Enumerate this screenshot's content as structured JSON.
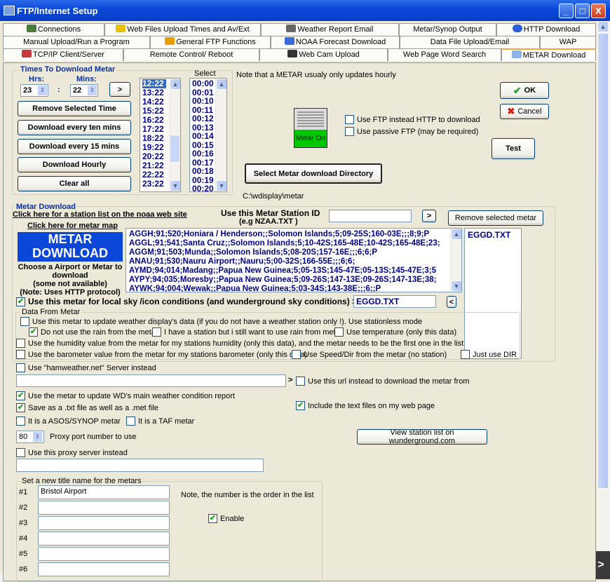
{
  "window": {
    "title": "FTP/Internet Setup",
    "min": "_",
    "max": "□",
    "close": "X"
  },
  "tabs_row1": [
    "Connections",
    "Web Files Upload Times and  Av/Ext",
    "Weather Report Email",
    "Metar/Synop Output",
    "HTTP Download"
  ],
  "tabs_row2": [
    "Manual Upload/Run a Program",
    "General FTP Functions",
    "NOAA Forecast Download",
    "Data File Upload/Email",
    "WAP"
  ],
  "tabs_row3": [
    "TCP/IP Client/Server",
    "Remote Control/ Reboot",
    "Web Cam Upload",
    "Web Page Word Search",
    "METAR Download"
  ],
  "times": {
    "group_label": "Times To Download Metar",
    "hrs_label": "Hrs:",
    "mins_label": "Mins:",
    "hrs_value": "23",
    "mins_value": "22",
    "colon": ":",
    "add_arrow": ">",
    "remove": "Remove Selected Time",
    "every10": "Download every ten mins",
    "every15": "Download every 15 mins",
    "hourly": "Download Hourly",
    "clear": "Clear all",
    "list": [
      "12:22",
      "13:22",
      "14:22",
      "15:22",
      "16:22",
      "17:22",
      "18:22",
      "19:22",
      "20:22",
      "21:22",
      "22:22",
      "23:22"
    ],
    "select_label": "Select",
    "select_list": [
      "00:00",
      "00:01",
      "00:10",
      "00:11",
      "00:12",
      "00:13",
      "00:14",
      "00:15",
      "00:16",
      "00:17",
      "00:18",
      "00:19",
      "00:20"
    ]
  },
  "note_hourly": "Note that a METAR usualy only updates hourly",
  "ok": "OK",
  "cancel": "Cancel",
  "test": "Test",
  "use_ftp": "Use FTP instead HTTP to download",
  "passive_ftp": "Use passive FTP (may be required)",
  "metar_on": "Metar On",
  "select_dir": "Select Metar download Directory",
  "dir_path": "C:\\wdisplay\\metar",
  "metar": {
    "group_label": "Metar Download",
    "noaa_link": "Click here for a station list on the noaa web site",
    "map_link": "Click here for metar map",
    "big1": "METAR",
    "big2": "DOWNLOAD",
    "choose": "Choose a Airport or Metar to download",
    "some": "(some not available)",
    "note": "(Note: Uses HTTP protocol)",
    "station_label": "Use this Metar Station ID",
    "station_eg": "(e.g NZAA.TXT )",
    "station_value": "",
    "go_arrow": ">",
    "remove_selected": "Remove selected metar",
    "stations": [
      "AGGH;91;520;Honiara / Henderson;;Solomon Islands;5;09-25S;160-03E;;;8;9;P",
      "AGGL;91;541;Santa Cruz;;Solomon Islands;5;10-42S;165-48E;10-42S;165-48E;23;",
      "AGGM;91;503;Munda;;Solomon Islands;5;08-20S;157-16E;;;6;6;P",
      "ANAU;91;530;Nauru Airport;;Nauru;5;00-32S;166-55E;;;6;6;",
      "AYMD;94;014;Madang;;Papua New Guinea;5;05-13S;145-47E;05-13S;145-47E;3;5",
      "AYPY;94;035;Moresby;;Papua New Guinea;5;09-26S;147-13E;09-26S;147-13E;38;",
      "AYWK;94;004;Wewak;;Papua New Guinea;5;03-34S;143-38E;;;6;;P"
    ],
    "selected_list": [
      "EGGD.TXT"
    ],
    "use_local": "Use this metar for local sky /icon conditions (and wunderground sky conditions) >",
    "local_value": "EGGD.TXT",
    "local_arrow": "<"
  },
  "dfm": {
    "label": "Data From Metar",
    "stationless": "Use this metar to update weather display's data (if you do not have a weather station only !). Use stationless mode",
    "no_rain": "Do not use the rain from the metar",
    "have_station": "I have a station but i still want to use rain from metar",
    "temp": "Use temperature (only this data)",
    "humidity": "Use the humidity value from the metar for my stations humidity (only this data), and the metar needs to be the first one in the list",
    "baro": "Use the barometer value from the metar for my stations barometer (only this data)",
    "speed": "Use Speed/Dir from the metar (no station)",
    "dir": "Just use DIR"
  },
  "ham": "Use \"hamweather.net\" Server instead",
  "url_arrow": ">",
  "url_instead": "Use this url instead to download the metar from",
  "update_wd": "Use the metar to update WD's main weather condition report",
  "save_txt": "Save as a .txt file as well as a .met file",
  "include_text": "Include the text files on my web page",
  "asos": "It is a ASOS/SYNOP metar",
  "taf": "It is a TAF metar",
  "proxy_port_value": "80",
  "proxy_port_label": "Proxy port number to use",
  "wunder_btn": "View station list on wunderground.com",
  "proxy_server": "Use this proxy server instead",
  "titles": {
    "label": "Set a new title name for the metars",
    "note": "Note, the number is the order in the list",
    "enable": "Enable",
    "rows": [
      {
        "n": "#1",
        "v": "Bristol Airport"
      },
      {
        "n": "#2",
        "v": ""
      },
      {
        "n": "#3",
        "v": ""
      },
      {
        "n": "#4",
        "v": ""
      },
      {
        "n": "#5",
        "v": ""
      },
      {
        "n": "#6",
        "v": ""
      }
    ]
  },
  "side_arrow": ">"
}
